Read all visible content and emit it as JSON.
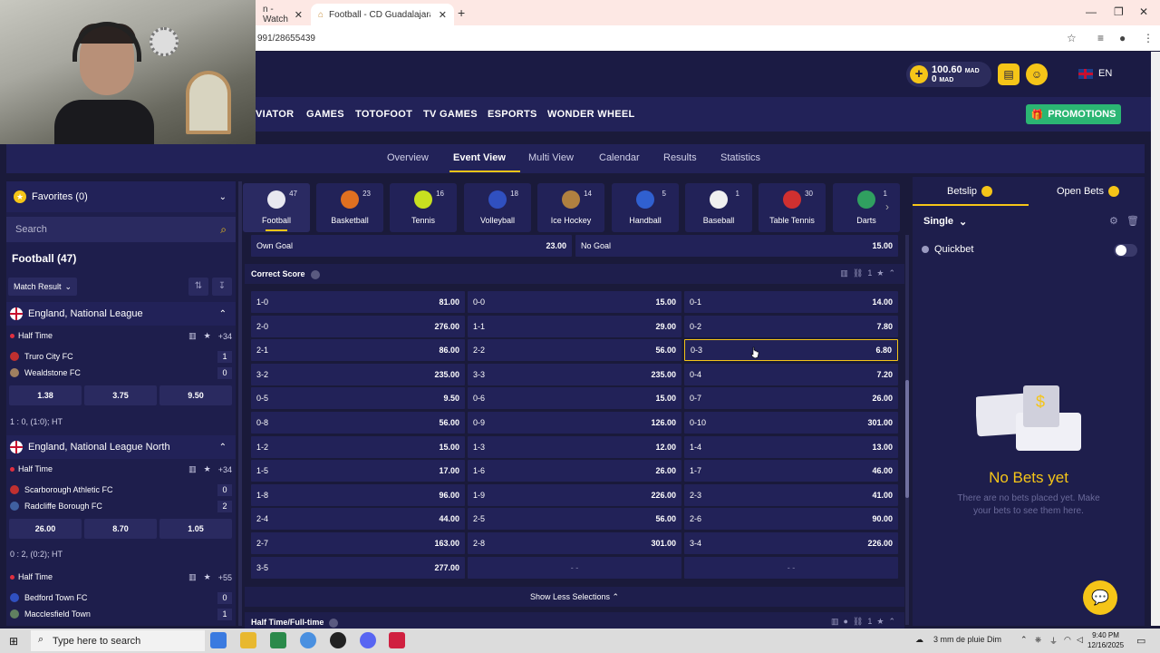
{
  "browser": {
    "tab1_label": "n - Watch",
    "tab2_label": "Football - CD Guadalajara SAD",
    "url": "991/28655439"
  },
  "header": {
    "balance": "100.60",
    "balance_currency": "MAD",
    "bonus": "0",
    "bonus_currency": "MAD",
    "lang": "EN"
  },
  "main_nav": {
    "items": [
      "VIATOR",
      "GAMES",
      "TOTOFOOT",
      "TV GAMES",
      "ESPORTS",
      "WONDER WHEEL"
    ],
    "promotions": "PROMOTIONS"
  },
  "sub_nav": {
    "items": [
      "Overview",
      "Event View",
      "Multi View",
      "Calendar",
      "Results",
      "Statistics"
    ],
    "active": "Event View"
  },
  "sidebar": {
    "favorites": "Favorites (0)",
    "search_placeholder": "Search",
    "sport_title": "Football (47)",
    "market_filter": "Match Result",
    "leagues": [
      {
        "name": "England, National League",
        "period": "Half Time",
        "more": "+34",
        "home": "Truro City FC",
        "home_score": "1",
        "away": "Wealdstone FC",
        "away_score": "0",
        "odds": [
          "1.38",
          "3.75",
          "9.50"
        ],
        "score_line": "1 : 0, (1:0); HT"
      },
      {
        "name": "England, National League North",
        "period": "Half Time",
        "more": "+34",
        "home": "Scarborough Athletic FC",
        "home_score": "0",
        "away": "Radcliffe Borough FC",
        "away_score": "2",
        "odds": [
          "26.00",
          "8.70",
          "1.05"
        ],
        "score_line": "0 : 2, (0:2); HT"
      },
      {
        "period": "Half Time",
        "more": "+55",
        "home": "Bedford Town FC",
        "home_score": "0",
        "away": "Macclesfield Town",
        "away_score": "1"
      }
    ]
  },
  "sports": [
    {
      "name": "Football",
      "count": "47",
      "color": "#e8e8f0"
    },
    {
      "name": "Basketball",
      "count": "23",
      "color": "#e07020"
    },
    {
      "name": "Tennis",
      "count": "16",
      "color": "#c8e020"
    },
    {
      "name": "Volleyball",
      "count": "18",
      "color": "#3050c0"
    },
    {
      "name": "Ice Hockey",
      "count": "14",
      "color": "#b08040"
    },
    {
      "name": "Handball",
      "count": "5",
      "color": "#3060d0"
    },
    {
      "name": "Baseball",
      "count": "1",
      "color": "#f0f0f0"
    },
    {
      "name": "Table Tennis",
      "count": "30",
      "color": "#d03030"
    },
    {
      "name": "Darts",
      "count": "1",
      "color": "#30a060"
    }
  ],
  "goal_market": {
    "own_goal": "Own Goal",
    "own_goal_odds": "23.00",
    "no_goal": "No Goal",
    "no_goal_odds": "15.00"
  },
  "correct_score": {
    "title": "Correct Score",
    "count": "1",
    "selected": "0-3",
    "rows": [
      [
        [
          "1-0",
          "81.00"
        ],
        [
          "0-0",
          "15.00"
        ],
        [
          "0-1",
          "14.00"
        ]
      ],
      [
        [
          "2-0",
          "276.00"
        ],
        [
          "1-1",
          "29.00"
        ],
        [
          "0-2",
          "7.80"
        ]
      ],
      [
        [
          "2-1",
          "86.00"
        ],
        [
          "2-2",
          "56.00"
        ],
        [
          "0-3",
          "6.80"
        ]
      ],
      [
        [
          "3-2",
          "235.00"
        ],
        [
          "3-3",
          "235.00"
        ],
        [
          "0-4",
          "7.20"
        ]
      ],
      [
        [
          "0-5",
          "9.50"
        ],
        [
          "0-6",
          "15.00"
        ],
        [
          "0-7",
          "26.00"
        ]
      ],
      [
        [
          "0-8",
          "56.00"
        ],
        [
          "0-9",
          "126.00"
        ],
        [
          "0-10",
          "301.00"
        ]
      ],
      [
        [
          "1-2",
          "15.00"
        ],
        [
          "1-3",
          "12.00"
        ],
        [
          "1-4",
          "13.00"
        ]
      ],
      [
        [
          "1-5",
          "17.00"
        ],
        [
          "1-6",
          "26.00"
        ],
        [
          "1-7",
          "46.00"
        ]
      ],
      [
        [
          "1-8",
          "96.00"
        ],
        [
          "1-9",
          "226.00"
        ],
        [
          "2-3",
          "41.00"
        ]
      ],
      [
        [
          "2-4",
          "44.00"
        ],
        [
          "2-5",
          "56.00"
        ],
        [
          "2-6",
          "90.00"
        ]
      ],
      [
        [
          "2-7",
          "163.00"
        ],
        [
          "2-8",
          "301.00"
        ],
        [
          "3-4",
          "226.00"
        ]
      ],
      [
        [
          "3-5",
          "277.00"
        ],
        [
          "",
          ""
        ],
        [
          "",
          ""
        ]
      ]
    ],
    "empty_mark": "- -",
    "show_less": "Show Less Selections"
  },
  "next_market": {
    "title": "Half Time/Full-time",
    "count": "1"
  },
  "betslip": {
    "tab_betslip": "Betslip",
    "tab_open": "Open Bets",
    "mode": "Single",
    "quickbet": "Quickbet",
    "empty_title": "No Bets yet",
    "empty_sub": "There are no bets placed yet. Make your bets to see them here."
  },
  "taskbar": {
    "search_placeholder": "Type here to search",
    "weather": "3 mm de pluie Dim",
    "time": "9:40 PM",
    "date": "12/16/2025"
  }
}
